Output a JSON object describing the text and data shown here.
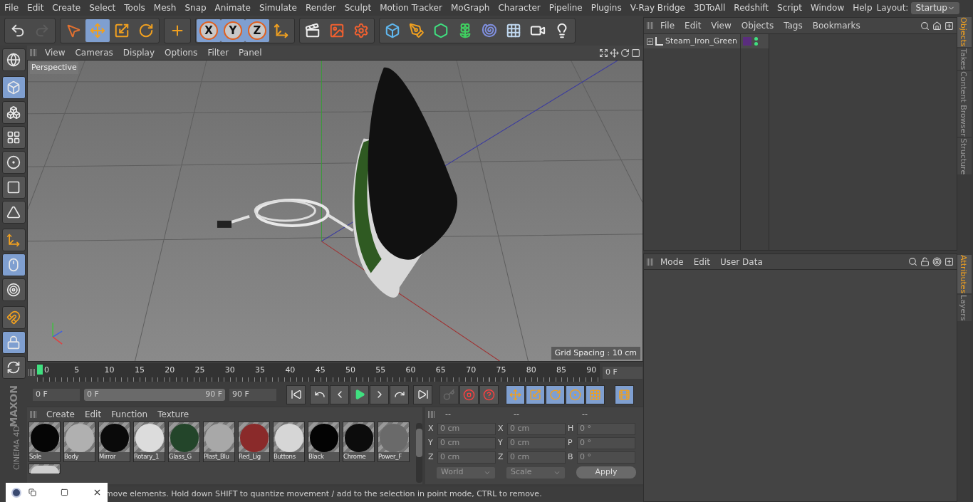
{
  "menu_bar": {
    "items": [
      "File",
      "Edit",
      "Create",
      "Select",
      "Tools",
      "Mesh",
      "Snap",
      "Animate",
      "Simulate",
      "Render",
      "Sculpt",
      "Motion Tracker",
      "MoGraph",
      "Character",
      "Pipeline",
      "Plugins",
      "V-Ray Bridge",
      "3DToAll",
      "Redshift",
      "Script",
      "Window",
      "Help"
    ],
    "layout_label": "Layout:",
    "layout_value": "Startup"
  },
  "toolbar": {
    "groups": [
      [
        {
          "kind": "undo",
          "selected": false,
          "disabled": false
        },
        {
          "kind": "redo",
          "selected": false,
          "disabled": true
        }
      ],
      [
        {
          "kind": "select",
          "selected": false,
          "disabled": false
        },
        {
          "kind": "move",
          "selected": true,
          "disabled": false
        },
        {
          "kind": "scale",
          "selected": false,
          "disabled": false
        },
        {
          "kind": "rotate",
          "selected": false,
          "disabled": false
        }
      ],
      [
        {
          "kind": "add",
          "selected": false,
          "disabled": false
        }
      ],
      [
        {
          "kind": "axis",
          "label": "X",
          "selected": true,
          "disabled": false
        },
        {
          "kind": "axis",
          "label": "Y",
          "selected": true,
          "disabled": false
        },
        {
          "kind": "axis",
          "label": "Z",
          "selected": true,
          "disabled": false
        },
        {
          "kind": "coords",
          "selected": false,
          "disabled": false
        }
      ],
      [
        {
          "kind": "render",
          "selected": false,
          "disabled": false
        },
        {
          "kind": "render-picture",
          "selected": false,
          "disabled": false
        },
        {
          "kind": "render-settings",
          "selected": false,
          "disabled": false
        }
      ],
      [
        {
          "kind": "cube",
          "selected": false,
          "disabled": false
        },
        {
          "kind": "pen",
          "selected": false,
          "disabled": false
        },
        {
          "kind": "subdivision",
          "selected": false,
          "disabled": false
        },
        {
          "kind": "cloner",
          "selected": false,
          "disabled": false
        },
        {
          "kind": "deformer",
          "selected": false,
          "disabled": false
        },
        {
          "kind": "floor",
          "selected": false,
          "disabled": false
        },
        {
          "kind": "camera",
          "selected": false,
          "disabled": false
        },
        {
          "kind": "light",
          "selected": false,
          "disabled": false
        }
      ]
    ]
  },
  "left_palette": [
    {
      "kind": "globe",
      "selected": false
    },
    {
      "kind": "model",
      "selected": true
    },
    {
      "kind": "texture",
      "selected": false
    },
    {
      "kind": "workplane",
      "selected": false
    },
    {
      "kind": "points",
      "selected": false
    },
    {
      "kind": "edges",
      "selected": false
    },
    {
      "kind": "polygons",
      "selected": false
    },
    {
      "kind": "axis",
      "selected": false
    },
    {
      "kind": "tweak",
      "selected": true
    },
    {
      "kind": "solo",
      "selected": false
    },
    {
      "kind": "magnet",
      "selected": false
    },
    {
      "kind": "lock",
      "selected": true
    },
    {
      "kind": "sync",
      "selected": false
    }
  ],
  "logo": {
    "brand": "MAXON",
    "product": "CINEMA 4D"
  },
  "viewport": {
    "menu": [
      "View",
      "Cameras",
      "Display",
      "Options",
      "Filter",
      "Panel"
    ],
    "camera": "Perspective",
    "grid_spacing": "Grid Spacing : 10 cm"
  },
  "timeline": {
    "labels": [
      "0",
      "5",
      "10",
      "15",
      "20",
      "25",
      "30",
      "35",
      "40",
      "45",
      "50",
      "55",
      "60",
      "65",
      "70",
      "75",
      "80",
      "85",
      "90"
    ],
    "level": 0,
    "current_frame": "0 F"
  },
  "playback": {
    "start_field": "0 F",
    "range": {
      "start": "0 F",
      "end": "90 F",
      "level": 1
    },
    "end_field": "90 F",
    "buttons": [
      {
        "kind": "first"
      },
      {
        "kind": "prev-key"
      },
      {
        "kind": "prev-frame"
      },
      {
        "kind": "play"
      },
      {
        "kind": "next-frame"
      },
      {
        "kind": "next-key"
      },
      {
        "kind": "last"
      }
    ],
    "record": [
      {
        "kind": "motion",
        "disabled": true
      },
      {
        "kind": "record",
        "disabled": false
      },
      {
        "kind": "auto",
        "disabled": false
      }
    ],
    "keys": [
      {
        "kind": "position",
        "selected": true
      },
      {
        "kind": "scale",
        "selected": true
      },
      {
        "kind": "rotation",
        "selected": true
      },
      {
        "kind": "parameter",
        "selected": true
      },
      {
        "kind": "points",
        "selected": true
      }
    ]
  },
  "material_manager": {
    "menu": [
      "Create",
      "Edit",
      "Function",
      "Texture"
    ],
    "materials": [
      {
        "name": "Sole",
        "color": "#050505"
      },
      {
        "name": "Body",
        "color": "#b0b0b0"
      },
      {
        "name": "Mirror",
        "color": "#0a0a0a"
      },
      {
        "name": "Rotary_1",
        "color": "#dcdcdc"
      },
      {
        "name": "Glass_G",
        "color": "#23452a"
      },
      {
        "name": "Plast_Blu",
        "color": "#a8a8a8"
      },
      {
        "name": "Red_Lig",
        "color": "#8a2a2a"
      },
      {
        "name": "Buttons",
        "color": "#d6d6d6"
      },
      {
        "name": "Black",
        "color": "#030303"
      },
      {
        "name": "Chrome",
        "color": "#0c0c0c"
      },
      {
        "name": "Power_F",
        "color": "#6a6a6a"
      },
      {
        "color": "#cfcfcf"
      }
    ]
  },
  "coordinates": {
    "headers": [
      "--",
      "--",
      "--"
    ],
    "rows": [
      {
        "position_label": "X",
        "position": "0 cm",
        "size_label": "X",
        "size": "0 cm",
        "rotation_label": "H",
        "rotation": "0 °"
      },
      {
        "position_label": "Y",
        "position": "0 cm",
        "size_label": "Y",
        "size": "0 cm",
        "rotation_label": "P",
        "rotation": "0 °"
      },
      {
        "position_label": "Z",
        "position": "0 cm",
        "size_label": "Z",
        "size": "0 cm",
        "rotation_label": "B",
        "rotation": "0 °"
      }
    ],
    "space": "World",
    "mode": "Scale",
    "apply": "Apply"
  },
  "object_manager": {
    "menu": [
      "File",
      "Edit",
      "View",
      "Objects",
      "Tags",
      "Bookmarks"
    ],
    "objects": [
      {
        "name": "Steam_Iron_Green",
        "expanded": false,
        "color": "#5a2d7e"
      }
    ]
  },
  "attribute_manager": {
    "menu": [
      "Mode",
      "Edit",
      "User Data"
    ]
  },
  "side_tabs_top": [
    {
      "label": "Objects",
      "selected": true
    },
    {
      "label": "Takes",
      "selected": false
    },
    {
      "label": "Content Browser",
      "selected": false
    },
    {
      "label": "Structure",
      "selected": false
    }
  ],
  "side_tabs_bottom": [
    {
      "label": "Attributes",
      "selected": true
    },
    {
      "label": "Layers",
      "selected": false
    }
  ],
  "status_bar": "move elements. Hold down SHIFT to quantize movement / add to the selection in point mode, CTRL to remove."
}
